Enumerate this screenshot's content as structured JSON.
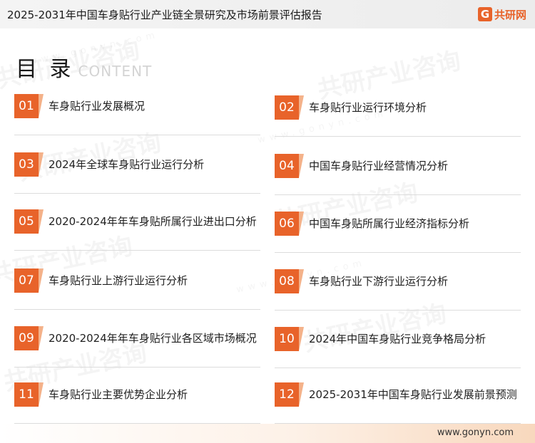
{
  "header": {
    "title": "2025-2031年中国车身贴行业产业链全景研究及市场前景评估报告",
    "brand_mark": "G",
    "brand_name": "共研网"
  },
  "heading": {
    "cn": "目 录",
    "en": "CONTENT"
  },
  "watermark": {
    "text": "共研产业咨询",
    "url": "www.gonyn.com"
  },
  "toc": [
    {
      "num": "01",
      "label": "车身贴行业发展概况"
    },
    {
      "num": "02",
      "label": "车身贴行业运行环境分析"
    },
    {
      "num": "03",
      "label": "2024年全球车身贴行业运行分析"
    },
    {
      "num": "04",
      "label": "中国车身贴行业经营情况分析"
    },
    {
      "num": "05",
      "label": "2020-2024年年车身贴所属行业进出口分析"
    },
    {
      "num": "06",
      "label": "中国车身贴所属行业经济指标分析"
    },
    {
      "num": "07",
      "label": "车身贴行业上游行业运行分析"
    },
    {
      "num": "08",
      "label": "车身贴行业下游行业运行分析"
    },
    {
      "num": "09",
      "label": "2020-2024年年车身贴行业各区域市场概况"
    },
    {
      "num": "10",
      "label": "2024年中国车身贴行业竞争格局分析"
    },
    {
      "num": "11",
      "label": "车身贴行业主要优势企业分析"
    },
    {
      "num": "12",
      "label": "2025-2031年中国车身贴行业发展前景预测"
    }
  ],
  "footer": {
    "url": "www.gonyn.com"
  },
  "colors": {
    "accent": "#e8632a",
    "accent_light": "#f4b28a"
  }
}
